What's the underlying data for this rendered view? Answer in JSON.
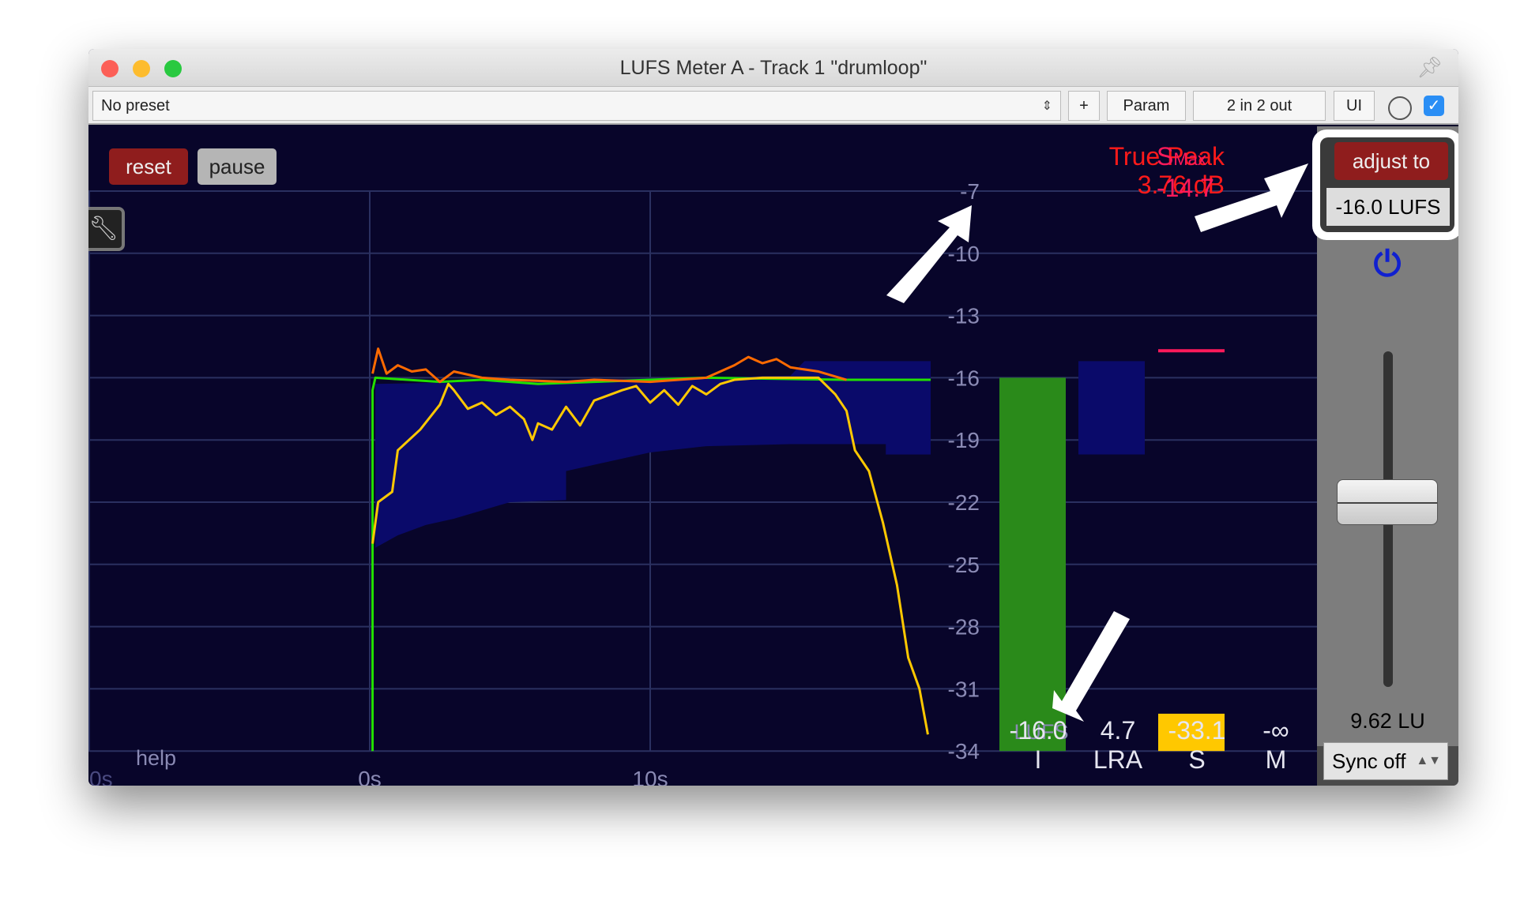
{
  "window": {
    "title": "LUFS Meter A - Track 1 \"drumloop\""
  },
  "toolbar": {
    "preset": "No preset",
    "plus": "+",
    "param": "Param",
    "io": "2 in 2 out",
    "ui": "UI",
    "enabled": true
  },
  "controls": {
    "reset": "reset",
    "pause": "pause",
    "help": "help",
    "settings_icon": "wrench-icon"
  },
  "graph": {
    "y_ticks": [
      "-7",
      "-10",
      "-13",
      "-16",
      "-19",
      "-22",
      "-25",
      "-28",
      "-31",
      "-34"
    ],
    "y_unit": "LUFS",
    "x_ticks": [
      {
        "t": -10,
        "label": "0s"
      },
      {
        "t": 0,
        "label": "0s"
      },
      {
        "t": 10,
        "label": "10s"
      }
    ],
    "colors": {
      "short_term": "#ffc800",
      "momentary": "#ff6a00",
      "peak": "#ff1a3a",
      "integrated": "#22e000",
      "range": "#0a0a6a"
    },
    "short_term": [
      [
        0.1,
        -24
      ],
      [
        0.3,
        -22
      ],
      [
        0.8,
        -21.5
      ],
      [
        1,
        -19.5
      ],
      [
        1.8,
        -18.5
      ],
      [
        2.5,
        -17.3
      ],
      [
        2.8,
        -16.3
      ],
      [
        3,
        -16.6
      ],
      [
        3.5,
        -17.5
      ],
      [
        4,
        -17.2
      ],
      [
        4.5,
        -17.8
      ],
      [
        5,
        -17.4
      ],
      [
        5.5,
        -18
      ],
      [
        5.8,
        -19
      ],
      [
        6,
        -18.2
      ],
      [
        6.5,
        -18.5
      ],
      [
        7,
        -17.4
      ],
      [
        7.5,
        -18.3
      ],
      [
        8,
        -17.1
      ],
      [
        9,
        -16.6
      ],
      [
        9.5,
        -16.4
      ],
      [
        10,
        -17.2
      ],
      [
        10.5,
        -16.6
      ],
      [
        11,
        -17.3
      ],
      [
        11.5,
        -16.4
      ],
      [
        12,
        -16.8
      ],
      [
        12.5,
        -16.3
      ],
      [
        13,
        -16.1
      ],
      [
        14,
        -16
      ],
      [
        15,
        -16
      ],
      [
        16,
        -16
      ],
      [
        16.6,
        -16.8
      ],
      [
        17,
        -17.6
      ],
      [
        17.3,
        -19.5
      ],
      [
        17.8,
        -20.5
      ],
      [
        18.3,
        -23
      ],
      [
        18.8,
        -26
      ],
      [
        19.2,
        -29.5
      ],
      [
        19.6,
        -31
      ],
      [
        19.9,
        -33.2
      ]
    ],
    "momentary": [
      [
        0.1,
        -15.8
      ],
      [
        0.3,
        -14.6
      ],
      [
        0.6,
        -15.8
      ],
      [
        1,
        -15.4
      ],
      [
        1.5,
        -15.7
      ],
      [
        2,
        -15.6
      ],
      [
        2.5,
        -16.2
      ],
      [
        3,
        -15.7
      ],
      [
        4,
        -16
      ],
      [
        5,
        -16.1
      ],
      [
        7,
        -16.2
      ],
      [
        8,
        -16.1
      ],
      [
        10,
        -16.2
      ],
      [
        12,
        -16
      ],
      [
        12.5,
        -15.7
      ],
      [
        13,
        -15.4
      ],
      [
        13.5,
        -15
      ],
      [
        14,
        -15.3
      ],
      [
        14.5,
        -15.1
      ],
      [
        15,
        -15.5
      ],
      [
        16,
        -15.7
      ],
      [
        17,
        -16.1
      ]
    ],
    "integrated": [
      [
        0.1,
        -34
      ],
      [
        0.1,
        -16.6
      ],
      [
        0.2,
        -16
      ],
      [
        2.5,
        -16.2
      ],
      [
        4,
        -16.1
      ],
      [
        6,
        -16.3
      ],
      [
        8,
        -16.2
      ],
      [
        10,
        -16.1
      ],
      [
        12,
        -16
      ],
      [
        17,
        -16.1
      ],
      [
        20,
        -16.1
      ]
    ],
    "range_top": [
      [
        0.2,
        -16.3
      ],
      [
        15,
        -15.9
      ],
      [
        15.5,
        -15.2
      ],
      [
        20,
        -15.2
      ]
    ],
    "range_bottom": [
      [
        0.2,
        -24.2
      ],
      [
        1,
        -23.6
      ],
      [
        2,
        -23.1
      ],
      [
        3,
        -22.8
      ],
      [
        4,
        -22.4
      ],
      [
        5,
        -22
      ],
      [
        7,
        -21.9
      ],
      [
        7,
        -20.5
      ],
      [
        10,
        -19.6
      ],
      [
        12,
        -19.3
      ],
      [
        15,
        -19.2
      ],
      [
        18.4,
        -19.2
      ],
      [
        18.4,
        -19.7
      ],
      [
        20,
        -19.7
      ]
    ]
  },
  "true_peak": {
    "label": "True Peak",
    "value": "3.76 dB"
  },
  "s_max": {
    "label": "S",
    "sub": "Max",
    "value": "-14.7"
  },
  "meters": [
    {
      "value": "-16.0",
      "label": "I",
      "level": -16.0
    },
    {
      "value": "4.7",
      "label": "LRA",
      "low": -19.7,
      "high": -15.2
    },
    {
      "value": "-33.1",
      "label": "S",
      "level": -33.1,
      "max": -14.7
    },
    {
      "value": "-∞",
      "label": "M"
    }
  ],
  "panel": {
    "adjust_to": "adjust to",
    "target": "-16.0 LUFS",
    "gain": "9.62 LU",
    "gain_fraction": 0.55,
    "sync": "Sync off"
  }
}
